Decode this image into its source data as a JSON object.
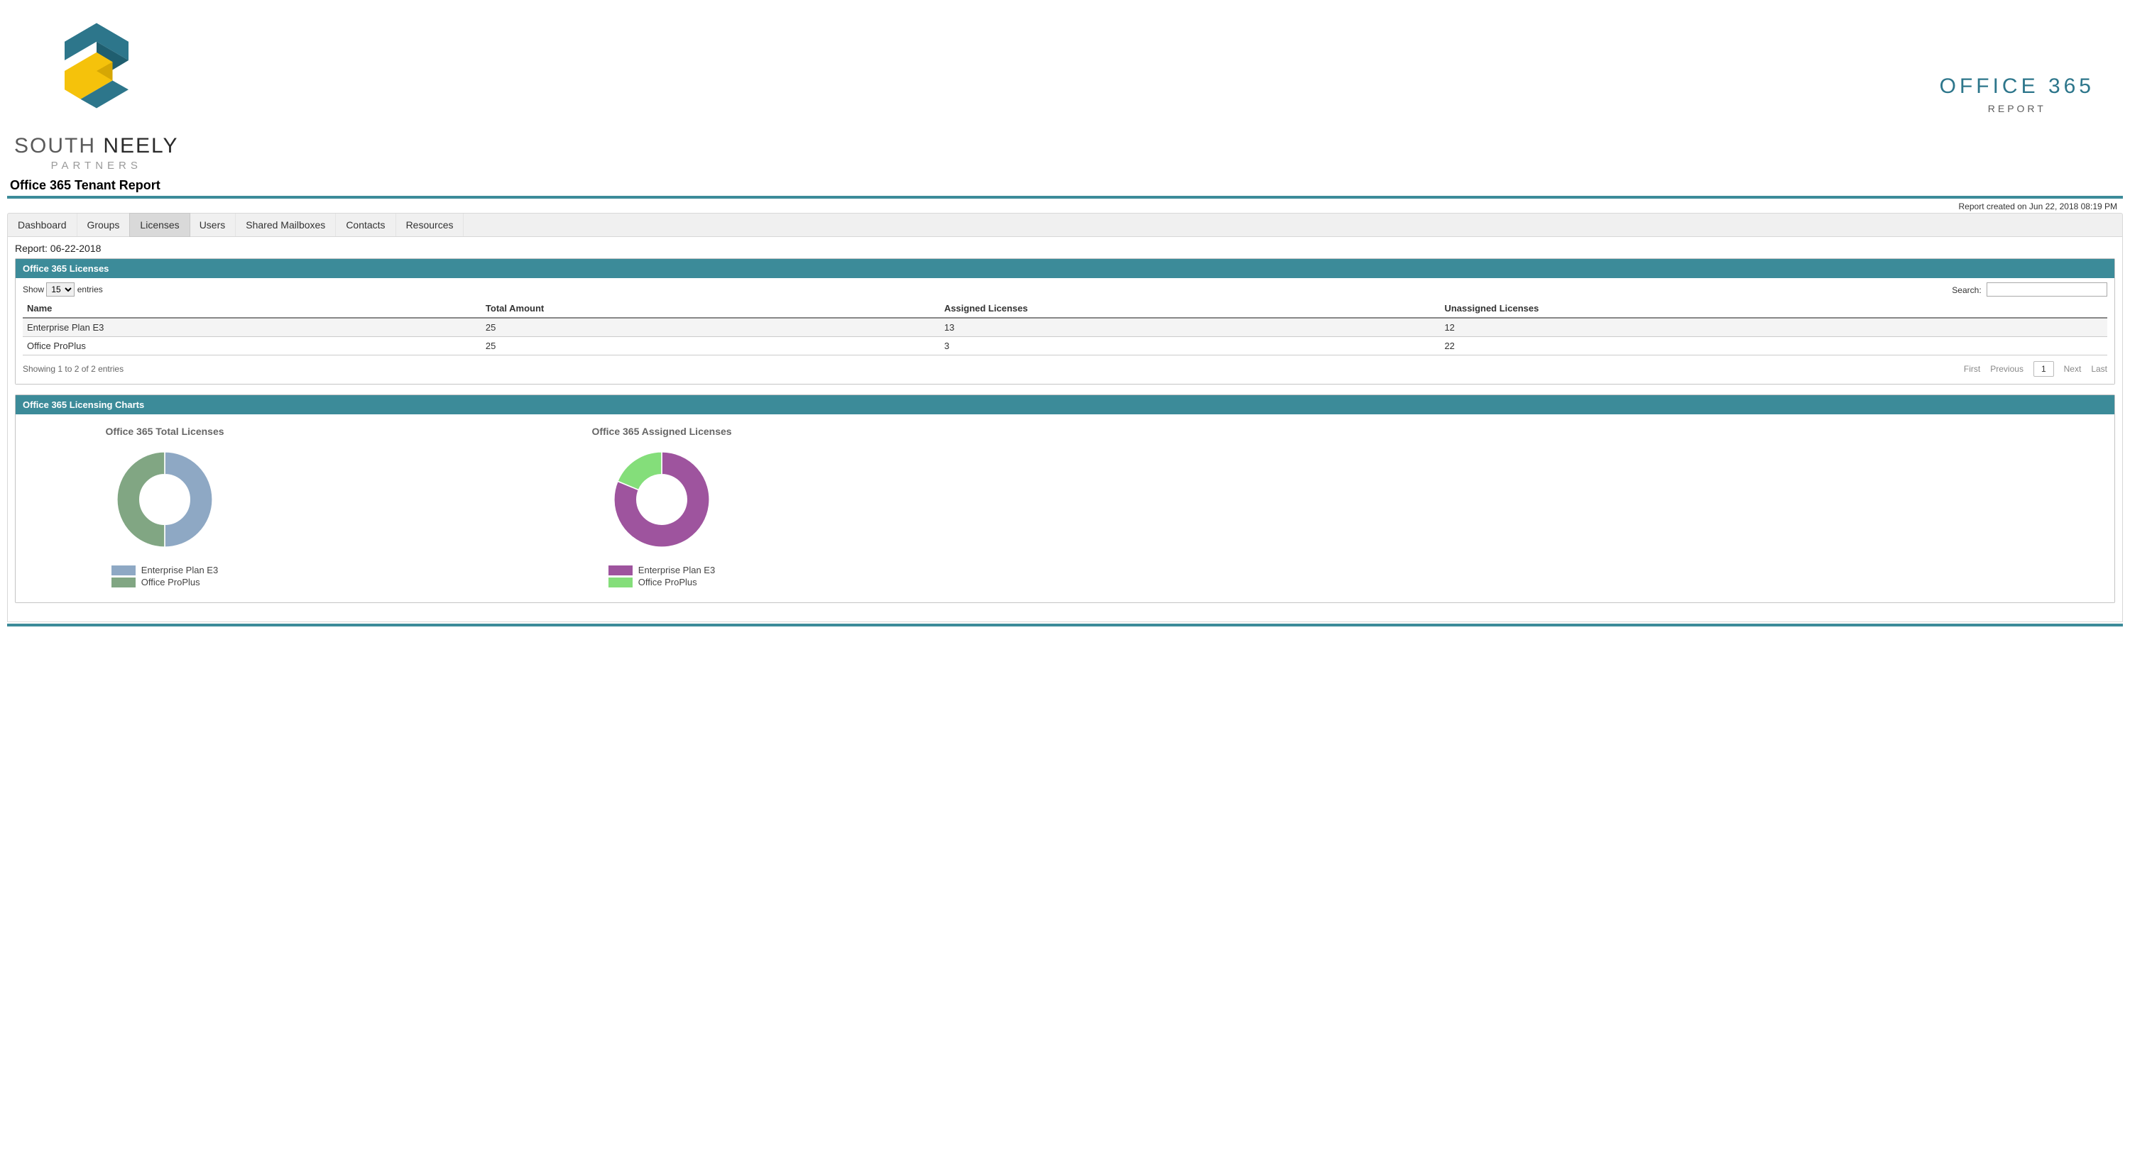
{
  "company": {
    "name_part1": "SOUTH",
    "name_part2": "NEELY",
    "name_sub": "PARTNERS"
  },
  "header": {
    "title": "OFFICE 365",
    "subtitle": "REPORT"
  },
  "page_title": "Office 365 Tenant Report",
  "created_on": "Report created on Jun 22, 2018 08:19 PM",
  "tabs": {
    "dashboard": "Dashboard",
    "groups": "Groups",
    "licenses": "Licenses",
    "users": "Users",
    "shared": "Shared Mailboxes",
    "contacts": "Contacts",
    "resources": "Resources"
  },
  "report_label": "Report: 06-22-2018",
  "licenses_panel": {
    "title": "Office 365 Licenses",
    "show_label": "Show",
    "entries_label": "entries",
    "entries_value": "15",
    "search_label": "Search:",
    "columns": {
      "name": "Name",
      "total": "Total Amount",
      "assigned": "Assigned Licenses",
      "unassigned": "Unassigned Licenses"
    },
    "rows": [
      {
        "name": "Enterprise Plan E3",
        "total": "25",
        "assigned": "13",
        "unassigned": "12"
      },
      {
        "name": "Office ProPlus",
        "total": "25",
        "assigned": "3",
        "unassigned": "22"
      }
    ],
    "showing": "Showing 1 to 2 of 2 entries",
    "pager": {
      "first": "First",
      "previous": "Previous",
      "page": "1",
      "next": "Next",
      "last": "Last"
    }
  },
  "charts_panel": {
    "title": "Office 365 Licensing Charts",
    "chart1_title": "Office 365 Total Licenses",
    "chart2_title": "Office 365 Assigned Licenses",
    "legend": {
      "ep": "Enterprise Plan E3",
      "opp": "Office ProPlus"
    }
  },
  "colors": {
    "accent": "#3c8b99",
    "chart1_a": "#8ea8c4",
    "chart1_b": "#81a683",
    "chart2_a": "#9e549e",
    "chart2_b": "#84de7a"
  },
  "chart_data": [
    {
      "type": "pie",
      "title": "Office 365 Total Licenses",
      "series": [
        {
          "name": "Enterprise Plan E3",
          "value": 25,
          "color": "#8ea8c4"
        },
        {
          "name": "Office ProPlus",
          "value": 25,
          "color": "#81a683"
        }
      ]
    },
    {
      "type": "pie",
      "title": "Office 365 Assigned Licenses",
      "series": [
        {
          "name": "Enterprise Plan E3",
          "value": 13,
          "color": "#9e549e"
        },
        {
          "name": "Office ProPlus",
          "value": 3,
          "color": "#84de7a"
        }
      ]
    }
  ]
}
